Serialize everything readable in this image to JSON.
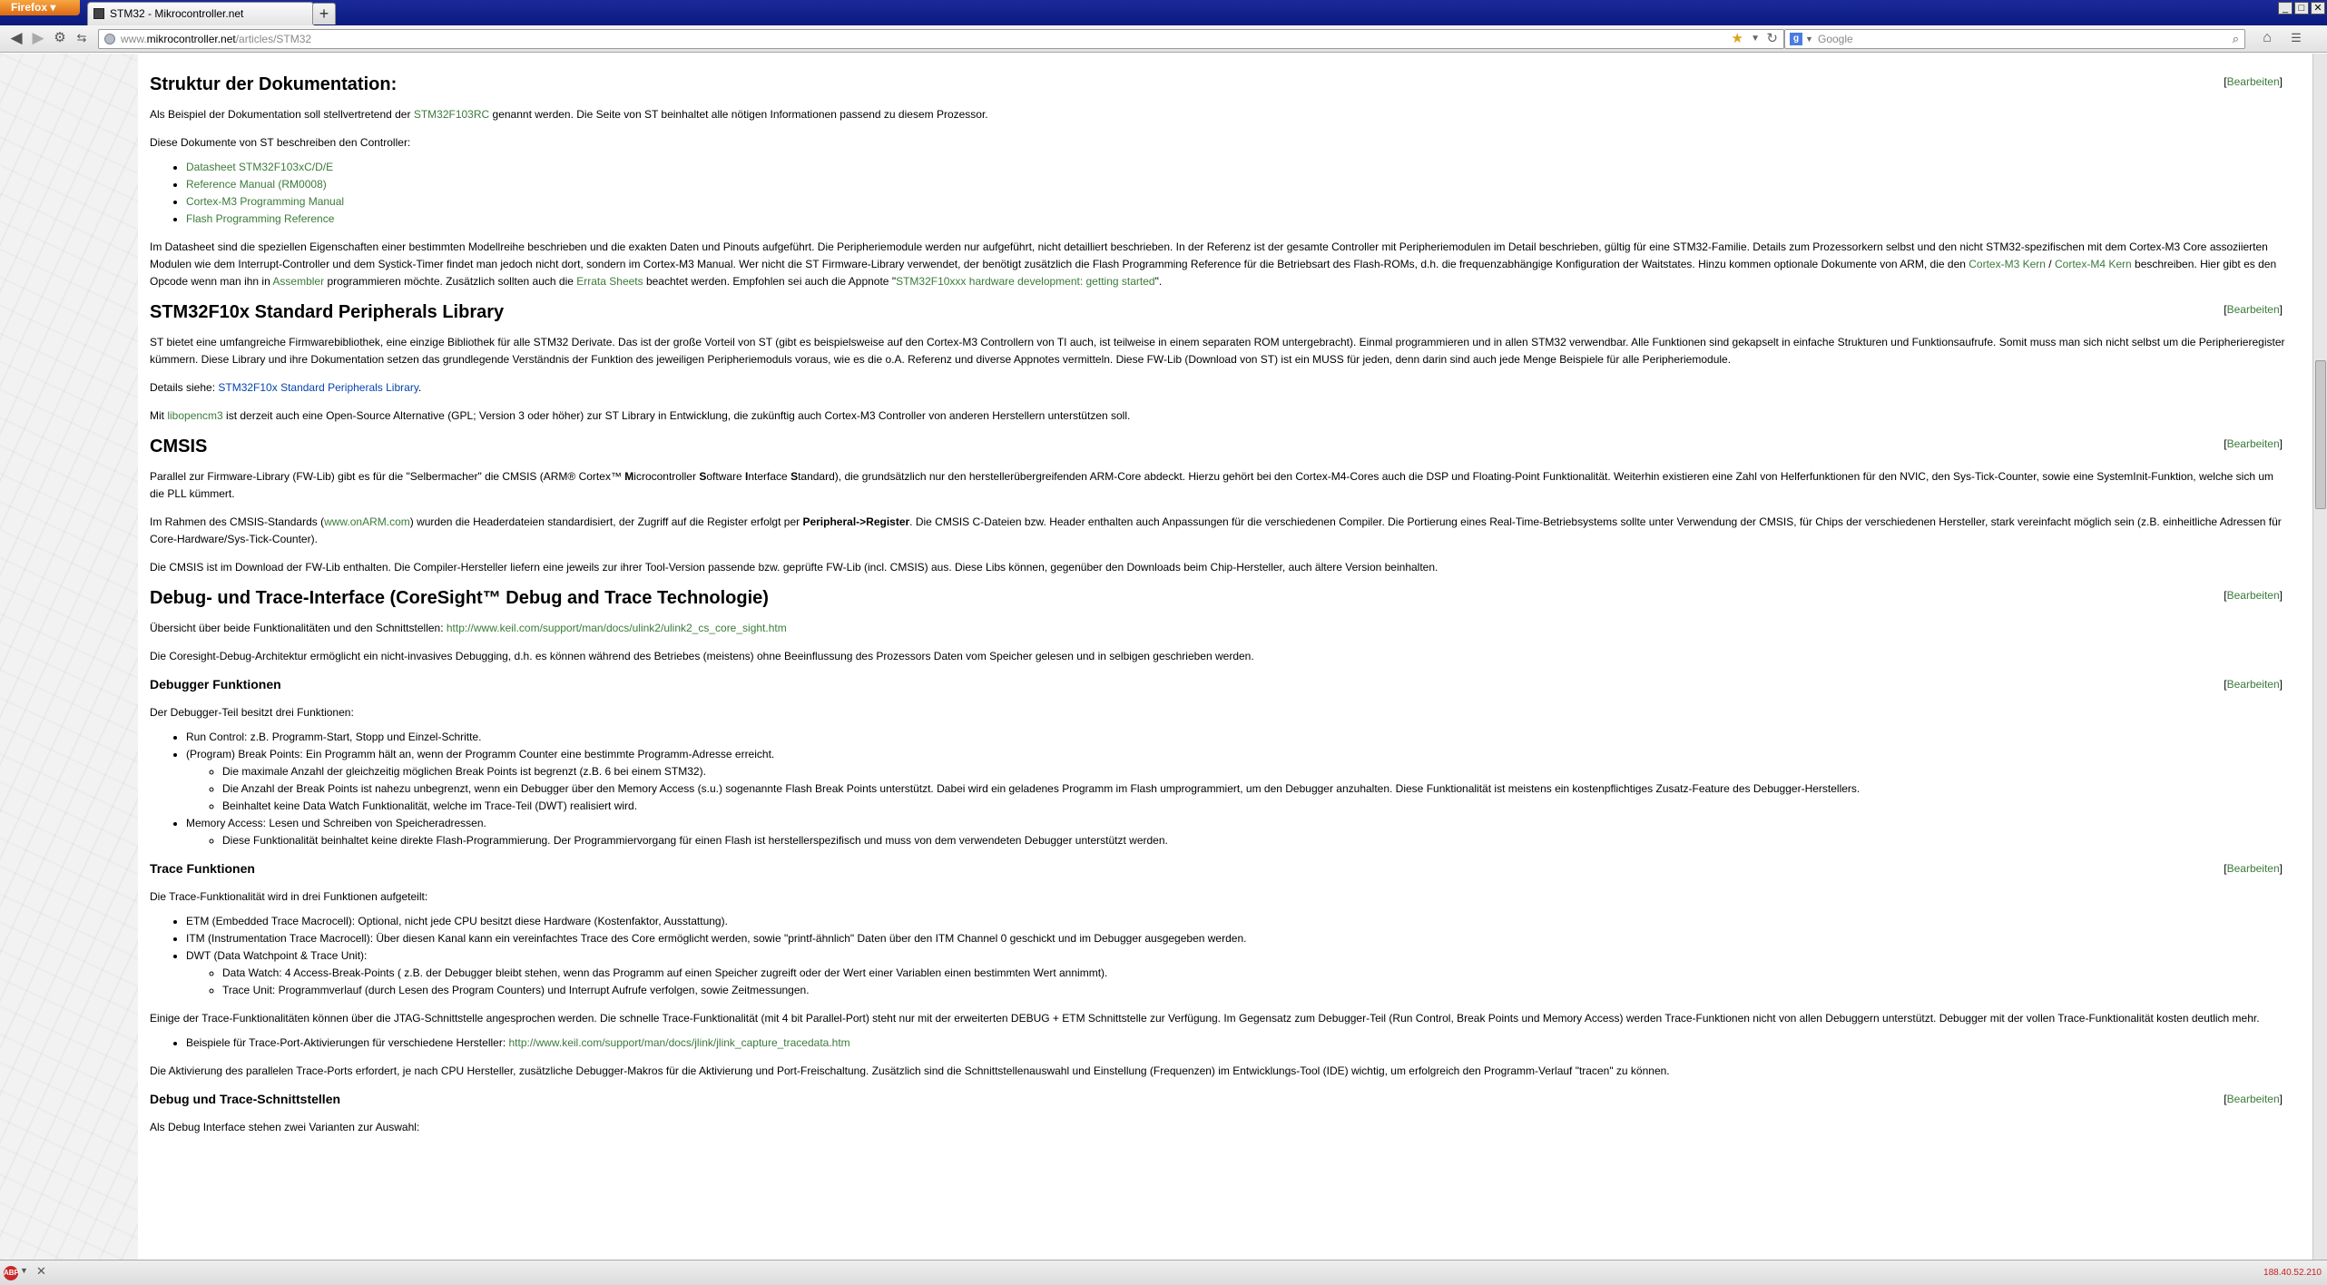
{
  "browser": {
    "menu_label": "Firefox",
    "tab_title": "STM32 - Mikrocontroller.net",
    "new_tab_label": "+",
    "url_prefix": "www.",
    "url_host": "mikrocontroller.net",
    "url_path": "/articles/STM32",
    "search_placeholder": "Google",
    "status_ip": "188.40.52.210",
    "adblock_label": "ABP"
  },
  "edit_label": "Bearbeiten",
  "sections": {
    "struktur": {
      "heading": "Struktur der Dokumentation:",
      "p1_a": "Als Beispiel der Dokumentation soll stellvertretend der ",
      "p1_link": "STM32F103RC",
      "p1_b": " genannt werden. Die Seite von ST beinhaltet alle nötigen Informationen passend zu diesem Prozessor.",
      "p2": "Diese Dokumente von ST beschreiben den Controller:",
      "docs": [
        "Datasheet STM32F103xC/D/E",
        "Reference Manual (RM0008)",
        "Cortex-M3 Programming Manual",
        "Flash Programming Reference"
      ],
      "p3_a": "Im Datasheet sind die speziellen Eigenschaften einer bestimmten Modellreihe beschrieben und die exakten Daten und Pinouts aufgeführt. Die Peripheriemodule werden nur aufgeführt, nicht detailliert beschrieben. In der Referenz ist der gesamte Controller mit Peripheriemodulen im Detail beschrieben, gültig für eine STM32-Familie. Details zum Prozessorkern selbst und den nicht STM32-spezifischen mit dem Cortex-M3 Core assoziierten Modulen wie dem Interrupt-Controller und dem Systick-Timer findet man jedoch nicht dort, sondern im Cortex-M3 Manual. Wer nicht die ST Firmware-Library verwendet, der benötigt zusätzlich die Flash Programming Reference für die Betriebsart des Flash-ROMs, d.h. die frequenzabhängige Konfiguration der Waitstates. Hinzu kommen optionale Dokumente von ARM, die den ",
      "p3_link1": "Cortex-M3 Kern",
      "p3_sep": " / ",
      "p3_link2": "Cortex-M4 Kern",
      "p3_b": " beschreiben. Hier gibt es den Opcode wenn man ihn in ",
      "p3_link3": "Assembler",
      "p3_c": " programmieren möchte. Zusätzlich sollten auch die ",
      "p3_link4": "Errata Sheets",
      "p3_d": " beachtet werden. Empfohlen sei auch die Appnote \"",
      "p3_link5": "STM32F10xxx hardware development: getting started",
      "p3_e": "\"."
    },
    "library": {
      "heading": "STM32F10x Standard Peripherals Library",
      "p1": "ST bietet eine umfangreiche Firmwarebibliothek, eine einzige Bibliothek für alle STM32 Derivate. Das ist der große Vorteil von ST (gibt es beispielsweise auf den Cortex-M3 Controllern von TI auch, ist teilweise in einem separaten ROM untergebracht). Einmal programmieren und in allen STM32 verwendbar. Alle Funktionen sind gekapselt in einfache Strukturen und Funktionsaufrufe. Somit muss man sich nicht selbst um die Peripherieregister kümmern. Diese Library und ihre Dokumentation setzen das grundlegende Verständnis der Funktion des jeweiligen Peripheriemoduls voraus, wie es die o.A. Referenz und diverse Appnotes vermitteln. Diese FW-Lib (Download von ST) ist ein MUSS für jeden, denn darin sind auch jede Menge Beispiele für alle Peripheriemodule.",
      "p2_a": "Details siehe: ",
      "p2_link": "STM32F10x Standard Peripherals Library",
      "p2_b": ".",
      "p3_a": "Mit ",
      "p3_link": "libopencm3",
      "p3_b": " ist derzeit auch eine Open-Source Alternative (GPL; Version 3 oder höher) zur ST Library in Entwicklung, die zukünftig auch Cortex-M3 Controller von anderen Herstellern unterstützen soll."
    },
    "cmsis": {
      "heading": "CMSIS",
      "p1_a": "Parallel zur Firmware-Library (FW-Lib) gibt es für die \"Selbermacher\" die CMSIS (ARM® Cortex™ ",
      "p1_b1": "M",
      "p1_c": "icrocontroller ",
      "p1_b2": "S",
      "p1_d": "oftware ",
      "p1_b3": "I",
      "p1_e": "nterface ",
      "p1_b4": "S",
      "p1_f": "tandard), die grundsätzlich nur den herstellerübergreifenden ARM-Core abdeckt. Hierzu gehört bei den Cortex-M4-Cores auch die DSP und Floating-Point Funktionalität. Weiterhin existieren eine Zahl von Helferfunktionen für den NVIC, den Sys-Tick-Counter, sowie eine SystemInit-Funktion, welche sich um die PLL kümmert.",
      "p2_a": "Im Rahmen des CMSIS-Standards (",
      "p2_link": "www.onARM.com",
      "p2_b": ") wurden die Headerdateien standardisiert, der Zugriff auf die Register erfolgt per ",
      "p2_bold": "Peripheral->Register",
      "p2_c": ". Die CMSIS C-Dateien bzw. Header enthalten auch Anpassungen für die verschiedenen Compiler. Die Portierung eines Real-Time-Betriebsystems sollte unter Verwendung der CMSIS, für Chips der verschiedenen Hersteller, stark vereinfacht möglich sein (z.B. einheitliche Adressen für Core-Hardware/Sys-Tick-Counter).",
      "p3": "Die CMSIS ist im Download der FW-Lib enthalten. Die Compiler-Hersteller liefern eine jeweils zur ihrer Tool-Version passende bzw. geprüfte FW-Lib (incl. CMSIS) aus. Diese Libs können, gegenüber den Downloads beim Chip-Hersteller, auch ältere Version beinhalten."
    },
    "debug": {
      "heading": "Debug- und Trace-Interface (CoreSight™ Debug and Trace Technologie)",
      "p1_a": "Übersicht über beide Funktionalitäten und den Schnittstellen: ",
      "p1_link": "http://www.keil.com/support/man/docs/ulink2/ulink2_cs_core_sight.htm",
      "p2": "Die Coresight-Debug-Architektur ermöglicht ein nicht-invasives Debugging, d.h. es können während des Betriebes (meistens) ohne Beeinflussung des Prozessors Daten vom Speicher gelesen und in selbigen geschrieben werden."
    },
    "debugger": {
      "heading": "Debugger Funktionen",
      "p1": "Der Debugger-Teil besitzt drei Funktionen:",
      "item1": "Run Control: z.B. Programm-Start, Stopp und Einzel-Schritte.",
      "item2": "(Program) Break Points: Ein Programm hält an, wenn der Programm Counter eine bestimmte Programm-Adresse erreicht.",
      "item2_sub": [
        "Die maximale Anzahl der gleichzeitig möglichen Break Points ist begrenzt (z.B. 6 bei einem STM32).",
        "Die Anzahl der Break Points ist nahezu unbegrenzt, wenn ein Debugger über den Memory Access (s.u.) sogenannte Flash Break Points unterstützt. Dabei wird ein geladenes Programm im Flash umprogrammiert, um den Debugger anzuhalten. Diese Funktionalität ist meistens ein kostenpflichtiges Zusatz-Feature des Debugger-Herstellers.",
        "Beinhaltet keine Data Watch Funktionalität, welche im Trace-Teil (DWT) realisiert wird."
      ],
      "item3": "Memory Access: Lesen und Schreiben von Speicheradressen.",
      "item3_sub": [
        "Diese Funktionalität beinhaltet keine direkte Flash-Programmierung. Der Programmiervorgang für einen Flash ist herstellerspezifisch und muss von dem verwendeten Debugger unterstützt werden."
      ]
    },
    "trace": {
      "heading": "Trace Funktionen",
      "p1": "Die Trace-Funktionalität wird in drei Funktionen aufgeteilt:",
      "item1": "ETM (Embedded Trace Macrocell): Optional, nicht jede CPU besitzt diese Hardware (Kostenfaktor, Ausstattung).",
      "item2": "ITM (Instrumentation Trace Macrocell): Über diesen Kanal kann ein vereinfachtes Trace des Core ermöglicht werden, sowie \"printf-ähnlich\" Daten über den ITM Channel 0 geschickt und im Debugger ausgegeben werden.",
      "item3": "DWT (Data Watchpoint & Trace Unit):",
      "item3_sub": [
        "Data Watch: 4 Access-Break-Points ( z.B. der Debugger bleibt stehen, wenn das Programm auf einen Speicher zugreift oder der Wert einer Variablen einen bestimmten Wert annimmt).",
        "Trace Unit: Programmverlauf (durch Lesen des Program Counters) und Interrupt Aufrufe verfolgen, sowie Zeitmessungen."
      ],
      "p2": "Einige der Trace-Funktionalitäten können über die JTAG-Schnittstelle angesprochen werden. Die schnelle Trace-Funktionalität (mit 4 bit Parallel-Port) steht nur mit der erweiterten DEBUG + ETM Schnittstelle zur Verfügung. Im Gegensatz zum Debugger-Teil (Run Control, Break Points und Memory Access) werden Trace-Funktionen nicht von allen Debuggern unterstützt. Debugger mit der vollen Trace-Funktionalität kosten deutlich mehr.",
      "bullet_a": "Beispiele für Trace-Port-Aktivierungen für verschiedene Hersteller: ",
      "bullet_link": "http://www.keil.com/support/man/docs/jlink/jlink_capture_tracedata.htm",
      "p3": "Die Aktivierung des parallelen Trace-Ports erfordert, je nach CPU Hersteller, zusätzliche Debugger-Makros für die Aktivierung und Port-Freischaltung. Zusätzlich sind die Schnittstellenauswahl und Einstellung (Frequenzen) im Entwicklungs-Tool (IDE) wichtig, um erfolgreich den Programm-Verlauf \"tracen\" zu können."
    },
    "schnittstellen": {
      "heading": "Debug und Trace-Schnittstellen",
      "p1": "Als Debug Interface stehen zwei Varianten zur Auswahl:"
    }
  }
}
